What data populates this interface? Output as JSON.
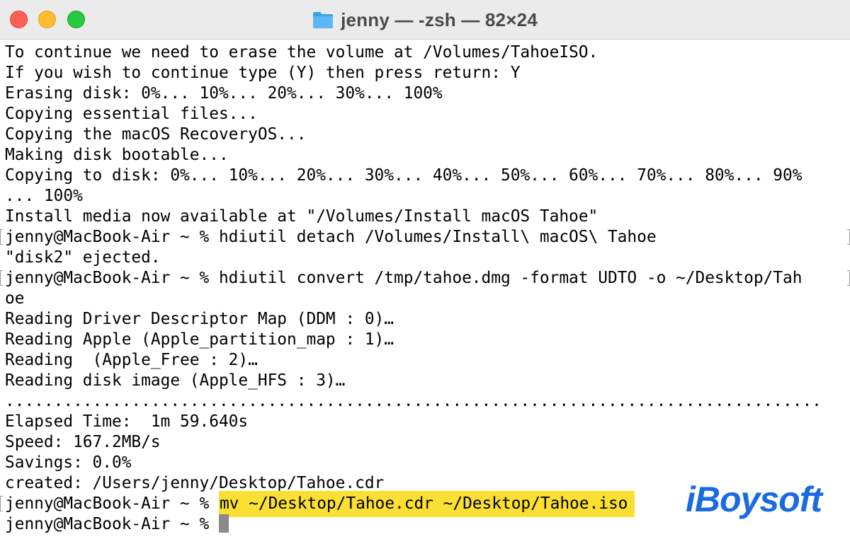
{
  "window": {
    "title": "jenny — -zsh — 82×24",
    "folder_icon": "folder-icon",
    "buttons": [
      "close",
      "minimize",
      "zoom"
    ],
    "colors": {
      "close": "#fe5f57",
      "minimize": "#febc2e",
      "zoom": "#28c840"
    }
  },
  "terminal": {
    "lines": [
      "To continue we need to erase the volume at /Volumes/TahoeISO.",
      "If you wish to continue type (Y) then press return: Y",
      "Erasing disk: 0%... 10%... 20%... 30%... 100%",
      "Copying essential files...",
      "Copying the macOS RecoveryOS...",
      "Making disk bootable...",
      "Copying to disk: 0%... 10%... 20%... 30%... 40%... 50%... 60%... 70%... 80%... 90%",
      "... 100%",
      "Install media now available at \"/Volumes/Install macOS Tahoe\"",
      "jenny@MacBook-Air ~ % hdiutil detach /Volumes/Install\\ macOS\\ Tahoe",
      "\"disk2\" ejected.",
      "jenny@MacBook-Air ~ % hdiutil convert /tmp/tahoe.dmg -format UDTO -o ~/Desktop/Tah",
      "oe",
      "Reading Driver Descriptor Map (DDM : 0)…",
      "Reading Apple (Apple_partition_map : 1)…",
      "Reading  (Apple_Free : 2)…",
      "Reading disk image (Apple_HFS : 3)…",
      "....................................................................................",
      "Elapsed Time:  1m 59.640s",
      "Speed: 167.2MB/s",
      "Savings: 0.0%",
      "created: /Users/jenny/Desktop/Tahoe.cdr"
    ],
    "highlight_prompt": "jenny@MacBook-Air ~ % ",
    "highlight_command": "mv ~/Desktop/Tahoe.cdr ~/Desktop/Tahoe.iso",
    "final_prompt": "jenny@MacBook-Air ~ % ",
    "highlight_color": "#fbe033"
  },
  "watermark": {
    "text": "iBoysoft",
    "color": "#1b6ae0"
  }
}
